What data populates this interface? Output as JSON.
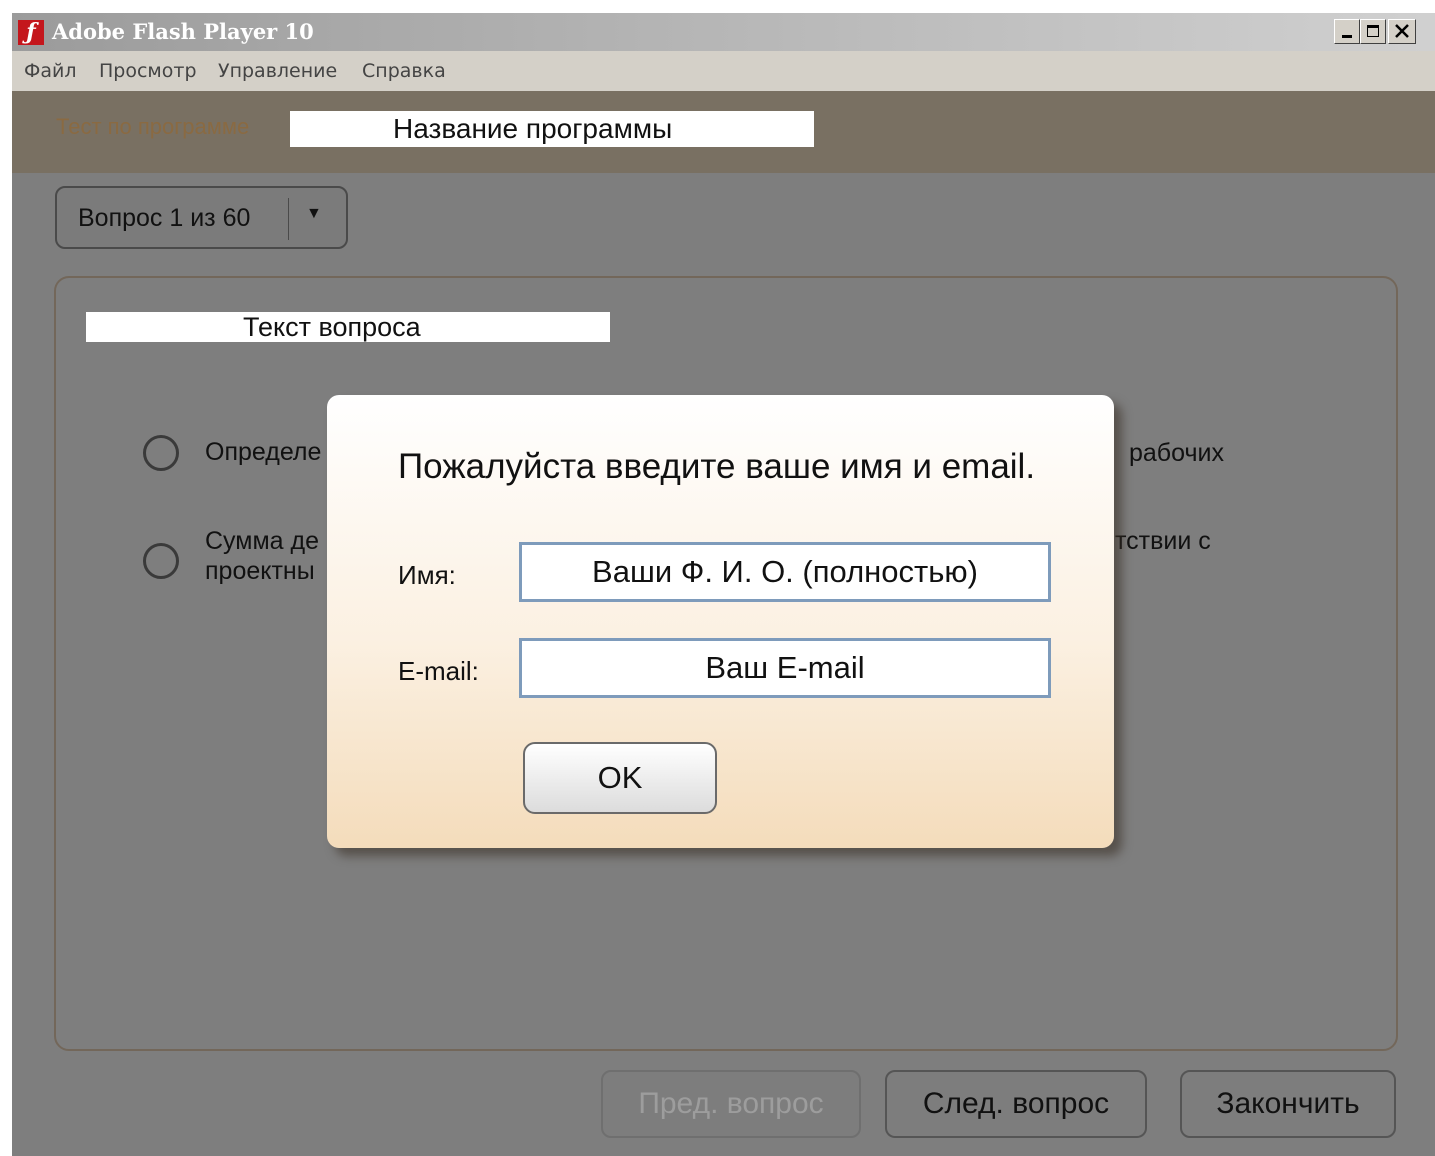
{
  "window": {
    "title": "Adobe Flash Player 10",
    "controls": [
      "minimize-icon",
      "maximize-icon",
      "close-icon"
    ]
  },
  "menubar": {
    "items": [
      "Файл",
      "Просмотр",
      "Управление",
      "Справка"
    ]
  },
  "header": {
    "label": "Тест по программе",
    "program_name": "Название программы"
  },
  "question_selector": {
    "value": "Вопрос 1 из 60",
    "icon": "chevron-down-icon"
  },
  "question": {
    "text": "Текст вопроса",
    "answers": [
      {
        "left": "Определе",
        "right": "рабочих"
      },
      {
        "left": "Сумма де\nпроектны",
        "right": "тствии с"
      }
    ]
  },
  "navigation": {
    "prev": "Пред. вопрос",
    "next": "След. вопрос",
    "finish": "Закончить"
  },
  "dialog": {
    "title": "Пожалуйста введите ваше имя и email.",
    "name_label": "Имя:",
    "name_value": "Ваши Ф. И. О. (полностью)",
    "email_label": "E-mail:",
    "email_value": "Ваш E-mail",
    "ok_label": "OK"
  },
  "colors": {
    "overlay": "#7e7e7e",
    "header_tint": "#797062",
    "header_label": "#8a6a42",
    "dialog_gradient_end": "#f4dcbb",
    "input_border": "#7e9bbb",
    "flash_red": "#c4161c"
  }
}
